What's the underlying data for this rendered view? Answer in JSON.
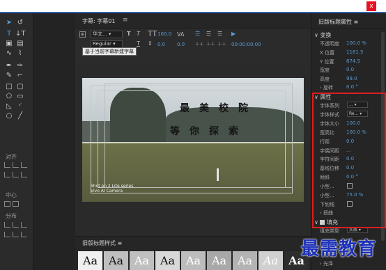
{
  "window": {
    "close_label": "x"
  },
  "tools_panel": {
    "align_label": "对齐",
    "center_label": "中心",
    "distribute_label": "分布"
  },
  "center": {
    "tab_title": "字幕: 字幕01",
    "tab_menu": "≡",
    "font_family": "华文...",
    "font_style": "Regular",
    "font_size": "100.0",
    "leading": "0.0",
    "kerning": "0.0",
    "timecode": "00:00:00:00",
    "tooltip": "基于当前字幕新建字幕"
  },
  "preview": {
    "line1": "最美校院",
    "line2": "等你探索",
    "watermark_line1": "Shot on 2 Lite series",
    "watermark_line2": "Vivo AI Camera"
  },
  "styles": {
    "title": "旧版标题样式",
    "menu": "≡",
    "swatch_label": "Aa"
  },
  "props": {
    "title": "旧版标题属性",
    "menu": "≡",
    "transform_label": "变换",
    "opacity_label": "不透明度",
    "opacity_value": "100.0 %",
    "xpos_label": "X 位置",
    "xpos_value": "1181.5",
    "ypos_label": "Y 位置",
    "ypos_value": "874.5",
    "width_label": "宽度",
    "width_value": "0.0",
    "height_label": "高度",
    "height_value": "99.0",
    "rotation_label": "旋转",
    "rotation_value": "0.0 °",
    "properties_label": "属性",
    "font_family_label": "字体系列",
    "font_family_value": "...",
    "font_style_label": "字体样式",
    "font_style_value": "Re...",
    "font_size_label": "字体大小",
    "font_size_value": "100.0",
    "aspect_label": "宽高比",
    "aspect_value": "100.0 %",
    "leading_label": "行距",
    "leading_value": "0.0",
    "kerning_label": "字偶间距",
    "kerning_value": "...",
    "tracking_label": "字符间距",
    "tracking_value": "0.0",
    "baseline_label": "基线位移",
    "baseline_value": "0.0",
    "slant_label": "倾斜",
    "slant_value": "0.0 °",
    "smallcaps_label": "小型...",
    "smallcaps_size_label": "小型...",
    "smallcaps_size_value": "75.0 %",
    "underline_label": "下划线",
    "distort_label": "扭曲",
    "fill_label": "填充",
    "fill_type_label": "填充类型",
    "fill_type_value": "实底",
    "sheen_label": "光泽"
  },
  "brand": "最需教育",
  "colors": {
    "accent_blue": "#5b9bd5",
    "highlight_red": "#e01d1d",
    "brand_blue": "#1c31b8"
  }
}
